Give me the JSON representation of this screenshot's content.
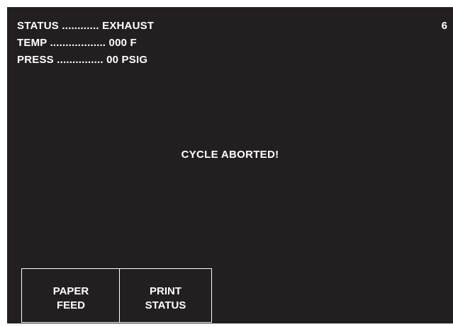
{
  "header": {
    "status_line": "STATUS ............ EXHAUST",
    "temp_line": "TEMP .................. 000 F",
    "press_line": "PRESS ............... 00 PSIG",
    "screen_number": "6"
  },
  "main": {
    "message": "CYCLE ABORTED!"
  },
  "softkeys": {
    "paper_feed": {
      "line1": "PAPER",
      "line2": "FEED"
    },
    "print_status": {
      "line1": "PRINT",
      "line2": "STATUS"
    }
  },
  "colors": {
    "screen_background": "#231f20",
    "text": "#ffffff"
  }
}
